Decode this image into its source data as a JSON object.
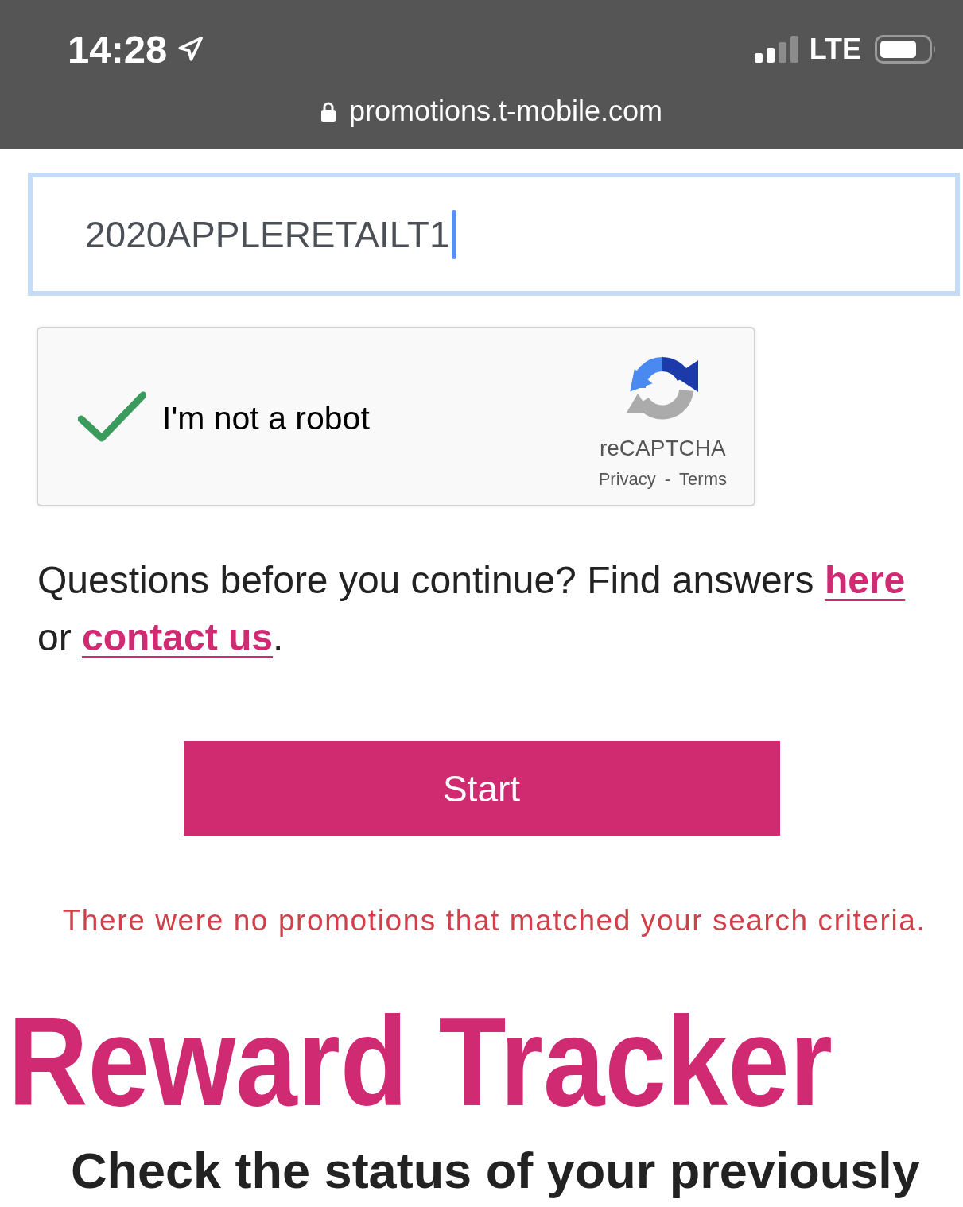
{
  "status_bar": {
    "time": "14:28",
    "network": "LTE",
    "url": "promotions.t-mobile.com"
  },
  "promo_code_field": {
    "value": "2020APPLERETAILT1",
    "focused": true
  },
  "recaptcha": {
    "label": "I'm not a robot",
    "checked": true,
    "brand": "reCAPTCHA",
    "links": [
      "Privacy",
      "Terms"
    ],
    "separator": "-"
  },
  "help_text": [
    {
      "kind": "text",
      "text": "Questions before you continue? Find answers "
    },
    {
      "kind": "link",
      "text": "here"
    },
    {
      "kind": "text",
      "text": " or "
    },
    {
      "kind": "link",
      "text": "contact us"
    },
    {
      "kind": "text",
      "text": "."
    }
  ],
  "start_button": {
    "label": "Start"
  },
  "error_message": "There were no promotions that matched your search criteria.",
  "reward_tracker": {
    "title": "Reward Tracker",
    "subtitle": "Check the status of your previously"
  }
}
